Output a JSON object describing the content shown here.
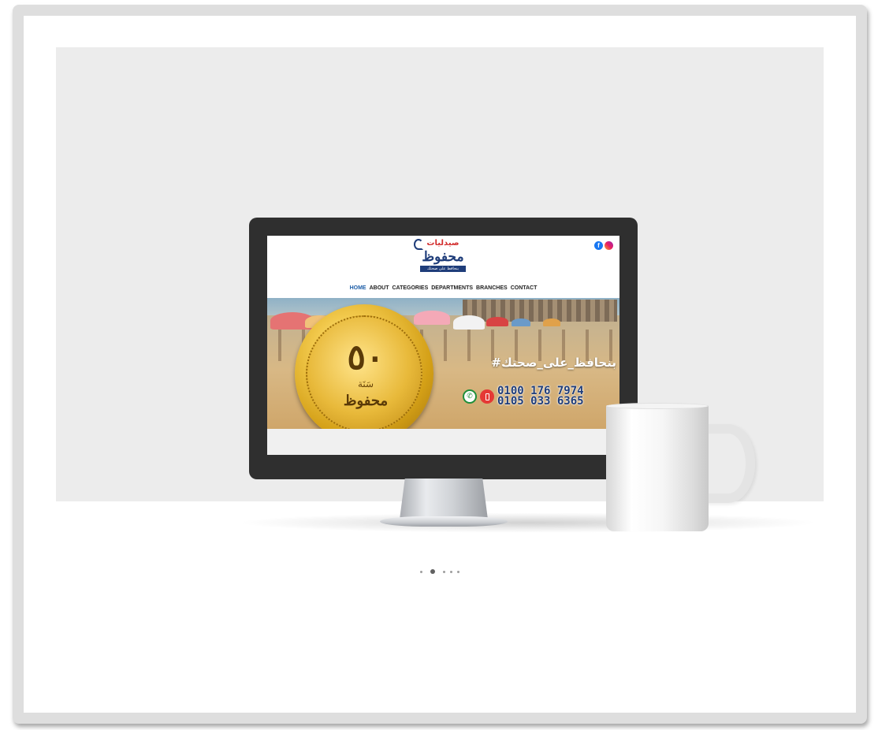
{
  "site": {
    "logo_top": "صيدليات",
    "logo_main": "محفوظ",
    "logo_strip": "بنحافظ على صحتك",
    "facebook_icon_glyph": "f",
    "nav": [
      "HOME",
      "ABOUT",
      "CATEGORIES",
      "DEPARTMENTS",
      "BRANCHES",
      "CONTACT"
    ],
    "active_nav": "HOME"
  },
  "hero": {
    "coin_number": "٥٠",
    "coin_sub": "سَنَة",
    "coin_name": "محفوظ",
    "hashtag": "#بنحافظ_على_صحتك",
    "phone_1": "0100 176 7974",
    "phone_2": "0105 033 6365",
    "whatsapp_glyph": "✆"
  },
  "carousel": {
    "total_dots": 5,
    "active_index": 1
  },
  "colors": {
    "brand_blue": "#1f3d7a",
    "brand_red": "#d32f2f",
    "frame": "#dedede",
    "backdrop": "#ececec"
  }
}
